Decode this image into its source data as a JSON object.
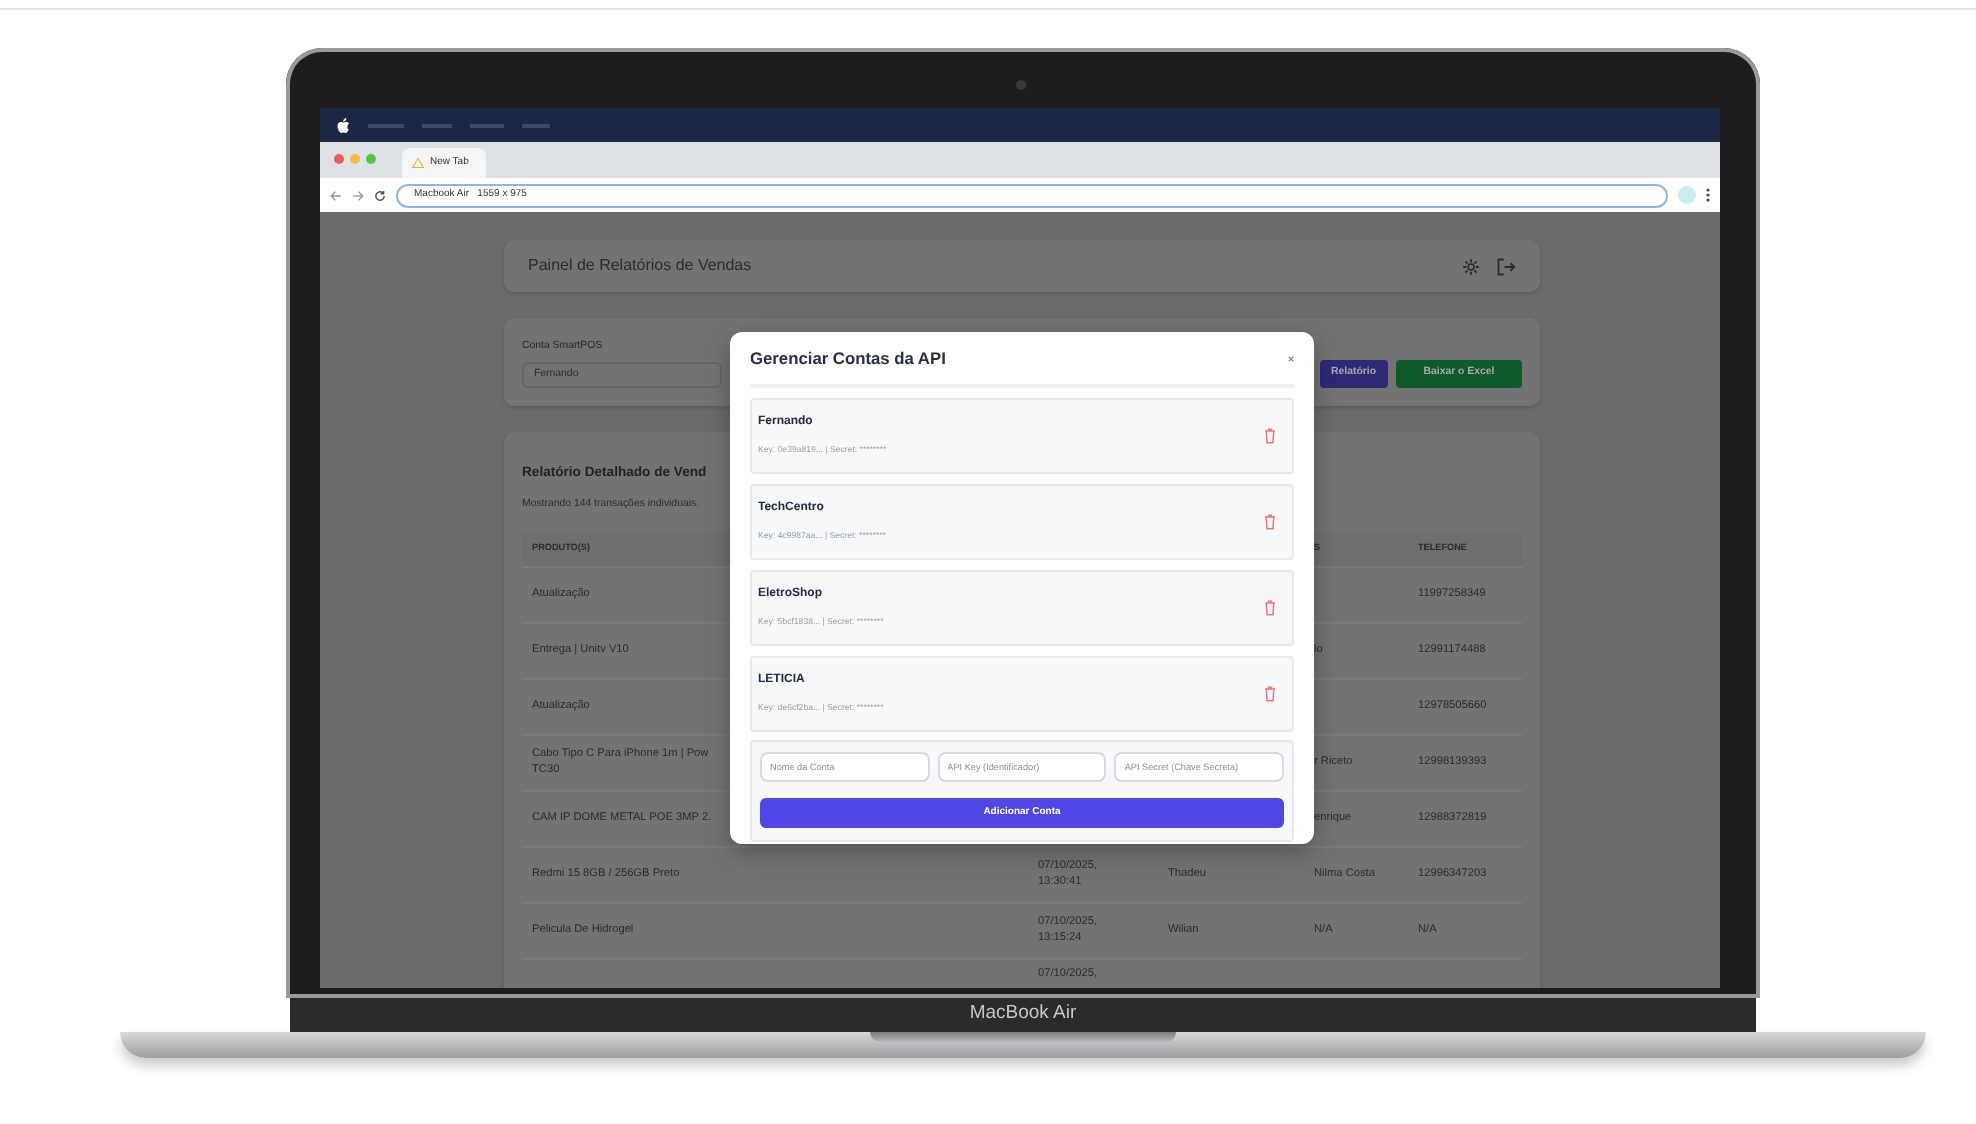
{
  "device": {
    "label": "MacBook Air"
  },
  "browser": {
    "tab_title": "New Tab",
    "address": "Macbook Air   1559 x 975"
  },
  "app": {
    "title": "Painel de Relatórios de Vendas",
    "filter": {
      "label": "Conta SmartPOS",
      "account": "Fernando",
      "buttons": [
        {
          "label": "Relatório",
          "kind": "primary"
        },
        {
          "label": "Baixar o Excel",
          "kind": "success"
        }
      ]
    },
    "report": {
      "title": "Relatório Detalhado de Vend",
      "subtitle": "Mostrando 144 transações individuais.",
      "header": {
        "product": "PRODUTO(S)",
        "client": "S",
        "phone": "TELEFONE"
      },
      "rows": [
        {
          "product": [
            "Atualização"
          ],
          "phone": "11997258349"
        },
        {
          "product": [
            "Entrega | Unitv V10"
          ],
          "client": "lo",
          "phone": "12991174488"
        },
        {
          "product": [
            "Atualização"
          ],
          "phone": "12978505660"
        },
        {
          "product": [
            "Cabo Tipo C Para iPhone 1m | Pow",
            "TC30"
          ],
          "client": "r Riceto",
          "phone": "12998139393"
        },
        {
          "product": [
            "CAM IP DOME METAL POE 3MP 2."
          ],
          "client": "enrique",
          "phone": "12988372819"
        },
        {
          "product": [
            "Redmi 15 8GB / 256GB Preto"
          ],
          "date": [
            "07/10/2025,",
            "13:30:41"
          ],
          "seller": "Thadeu",
          "client": "Nilma Costa",
          "phone": "12996347203"
        },
        {
          "product": [
            "Pelicula De Hidrogel"
          ],
          "date": [
            "07/10/2025,",
            "13:15:24"
          ],
          "seller": "Wilian",
          "client": "N/A",
          "phone": "N/A"
        },
        {
          "date": [
            "07/10/2025,"
          ]
        }
      ]
    }
  },
  "modal": {
    "title": "Gerenciar Contas da API",
    "accounts": [
      {
        "name": "Fernando",
        "key": "Key: 0e39a819... | Secret: ********"
      },
      {
        "name": "TechCentro",
        "key": "Key: 4c9987aa... | Secret: ********"
      },
      {
        "name": "EletroShop",
        "key": "Key: 5bcf1838... | Secret: ********"
      },
      {
        "name": "LETICIA",
        "key": "Key: de6cf2ba... | Secret: ********"
      }
    ],
    "form": {
      "placeholders": [
        "Nome da Conta",
        "API Key (Identificador)",
        "API Secret (Chave Secreta)"
      ],
      "submit": "Adicionar Conta"
    }
  }
}
